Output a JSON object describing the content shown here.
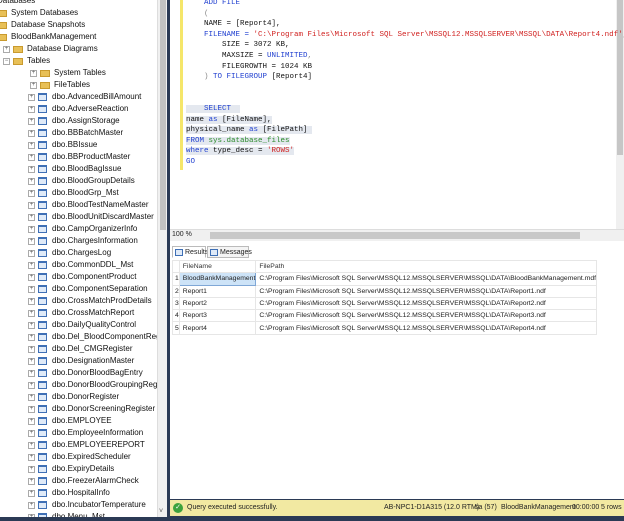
{
  "tree": {
    "items": [
      {
        "label": "Databases",
        "type": "root"
      },
      {
        "label": "System Databases",
        "type": "folder"
      },
      {
        "label": "Database Snapshots",
        "type": "folder"
      },
      {
        "label": "BloodBankManagement",
        "type": "db"
      },
      {
        "label": "Database Diagrams",
        "type": "folder"
      },
      {
        "label": "Tables",
        "type": "folder"
      },
      {
        "label": "System Tables",
        "type": "folder"
      },
      {
        "label": "FileTables",
        "type": "folder"
      },
      {
        "label": "dbo.AdvancedBillAmount",
        "type": "table"
      },
      {
        "label": "dbo.AdverseReaction",
        "type": "table"
      },
      {
        "label": "dbo.AssignStorage",
        "type": "table"
      },
      {
        "label": "dbo.BBBatchMaster",
        "type": "table"
      },
      {
        "label": "dbo.BBIssue",
        "type": "table"
      },
      {
        "label": "dbo.BBProductMaster",
        "type": "table"
      },
      {
        "label": "dbo.BloodBagIssue",
        "type": "table"
      },
      {
        "label": "dbo.BloodGroupDetails",
        "type": "table"
      },
      {
        "label": "dbo.BloodGrp_Mst",
        "type": "table"
      },
      {
        "label": "dbo.BloodTestNameMaster",
        "type": "table"
      },
      {
        "label": "dbo.BloodUnitDiscardMaster",
        "type": "table"
      },
      {
        "label": "dbo.CampOrganizerInfo",
        "type": "table"
      },
      {
        "label": "dbo.ChargesInformation",
        "type": "table"
      },
      {
        "label": "dbo.ChargesLog",
        "type": "table"
      },
      {
        "label": "dbo.CommonDDL_Mst",
        "type": "table"
      },
      {
        "label": "dbo.ComponentProduct",
        "type": "table"
      },
      {
        "label": "dbo.ComponentSeparation",
        "type": "table"
      },
      {
        "label": "dbo.CrossMatchProdDetails",
        "type": "table"
      },
      {
        "label": "dbo.CrossMatchReport",
        "type": "table"
      },
      {
        "label": "dbo.DailyQualityControl",
        "type": "table"
      },
      {
        "label": "dbo.Del_BloodComponentRegister",
        "type": "table"
      },
      {
        "label": "dbo.Del_CMGRegister",
        "type": "table"
      },
      {
        "label": "dbo.DesignationMaster",
        "type": "table"
      },
      {
        "label": "dbo.DonorBloodBagEntry",
        "type": "table"
      },
      {
        "label": "dbo.DonorBloodGroupingRegister",
        "type": "table"
      },
      {
        "label": "dbo.DonorRegister",
        "type": "table"
      },
      {
        "label": "dbo.DonorScreeningRegister",
        "type": "table"
      },
      {
        "label": "dbo.EMPLOYEE",
        "type": "table"
      },
      {
        "label": "dbo.EmployeeInformation",
        "type": "table"
      },
      {
        "label": "dbo.EMPLOYEEREPORT",
        "type": "table"
      },
      {
        "label": "dbo.ExpiredScheduler",
        "type": "table"
      },
      {
        "label": "dbo.ExpiryDetails",
        "type": "table"
      },
      {
        "label": "dbo.FreezerAlarmCheck",
        "type": "table"
      },
      {
        "label": "dbo.HospitalInfo",
        "type": "table"
      },
      {
        "label": "dbo.IncubatorTemperature",
        "type": "table"
      },
      {
        "label": "dbo.Menu_Mst",
        "type": "table"
      }
    ]
  },
  "editor": {
    "lines": [
      [
        {
          "t": "    ADD FILE",
          "c": "kw"
        }
      ],
      [
        {
          "t": "    (",
          "c": "gr"
        }
      ],
      [
        {
          "t": "    NAME = [Report4],",
          "c": ""
        }
      ],
      [
        {
          "t": "    FILENAME = ",
          "c": "kw"
        },
        {
          "t": "'C:\\Program Files\\Microsoft SQL Server\\MSSQL12.MSSQLSERVER\\MSSQL\\DATA\\Report4.ndf'",
          "c": "str"
        },
        {
          "t": ",",
          "c": "gr"
        }
      ],
      [
        {
          "t": "        SIZE = 3072 KB,",
          "c": ""
        }
      ],
      [
        {
          "t": "        MAXSIZE = ",
          "c": ""
        },
        {
          "t": "UNLIMITED",
          "c": "kw"
        },
        {
          "t": ",",
          "c": "gr"
        }
      ],
      [
        {
          "t": "        FILEGROWTH = 1024 KB",
          "c": ""
        }
      ],
      [
        {
          "t": "    ) ",
          "c": "gr"
        },
        {
          "t": "TO FILEGROUP",
          "c": "kw"
        },
        {
          "t": " [Report4]",
          "c": ""
        }
      ],
      [],
      [],
      [
        {
          "t": "    SELECT  ",
          "c": "kw sel"
        }
      ],
      [
        {
          "t": "name ",
          "c": "sel"
        },
        {
          "t": "as",
          "c": "kw sel"
        },
        {
          "t": " [FileName],",
          "c": "sel"
        }
      ],
      [
        {
          "t": "physical_name ",
          "c": "sel"
        },
        {
          "t": "as",
          "c": "kw sel"
        },
        {
          "t": " [FilePath] ",
          "c": "sel"
        }
      ],
      [
        {
          "t": "FROM ",
          "c": "kw sel"
        },
        {
          "t": "sys.database_files",
          "c": "sys sel"
        }
      ],
      [
        {
          "t": "where",
          "c": "kw sel"
        },
        {
          "t": " type_desc = ",
          "c": "sel"
        },
        {
          "t": "'ROWS'",
          "c": "str sel"
        }
      ],
      [
        {
          "t": "GO",
          "c": "kw"
        }
      ]
    ]
  },
  "zoom": "100 %",
  "tabs": {
    "results": "Results",
    "messages": "Messages"
  },
  "grid": {
    "headers": [
      "FileName",
      "FilePath"
    ],
    "rows": [
      {
        "n": "1",
        "name": "BloodBankManagement",
        "path": "C:\\Program Files\\Microsoft SQL Server\\MSSQL12.MSSQLSERVER\\MSSQL\\DATA\\BloodBankManagement.mdf"
      },
      {
        "n": "2",
        "name": "Report1",
        "path": "C:\\Program Files\\Microsoft SQL Server\\MSSQL12.MSSQLSERVER\\MSSQL\\DATA\\Report1.ndf"
      },
      {
        "n": "3",
        "name": "Report2",
        "path": "C:\\Program Files\\Microsoft SQL Server\\MSSQL12.MSSQLSERVER\\MSSQL\\DATA\\Report2.ndf"
      },
      {
        "n": "4",
        "name": "Report3",
        "path": "C:\\Program Files\\Microsoft SQL Server\\MSSQL12.MSSQLSERVER\\MSSQL\\DATA\\Report3.ndf"
      },
      {
        "n": "5",
        "name": "Report4",
        "path": "C:\\Program Files\\Microsoft SQL Server\\MSSQL12.MSSQLSERVER\\MSSQL\\DATA\\Report4.ndf"
      }
    ]
  },
  "status": {
    "message": "Query executed successfully.",
    "server": "AB-NPC1-D1A315 (12.0 RTM)",
    "user": "sa (57)",
    "database": "BloodBankManagement",
    "time": "00:00:00",
    "rows": "5 rows"
  }
}
